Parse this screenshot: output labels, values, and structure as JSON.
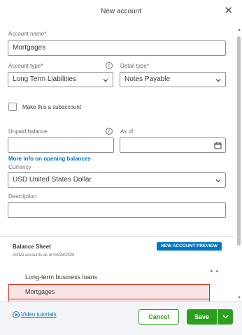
{
  "dialog": {
    "title": "New account",
    "close_icon": "close-icon"
  },
  "account_name": {
    "label": "Account name*",
    "value": "Mortgages"
  },
  "account_type": {
    "label": "Account type*",
    "value": "Long Term Liabilities",
    "info_icon": "info-icon"
  },
  "detail_type": {
    "label": "Detail type*",
    "value": "Notes Payable"
  },
  "subaccount": {
    "label": "Make this a subaccount",
    "checked": false
  },
  "unpaid_balance": {
    "label": "Unpaid balance",
    "value": "",
    "info_icon": "info-icon"
  },
  "as_of": {
    "label": "As of",
    "value": "",
    "icon": "calendar-icon"
  },
  "opening_balances_link": "More info on opening balances",
  "currency": {
    "label": "Currency",
    "value": "USD United States Dollar"
  },
  "description": {
    "label": "Description",
    "value": ""
  },
  "balance_sheet": {
    "title": "Balance Sheet",
    "subtitle": "Active accounts as of 04/28/2025",
    "badge": "NEW ACCOUNT PREVIEW",
    "items": [
      {
        "label": "Long-term business loans",
        "selected": false
      },
      {
        "label": "Mortgages",
        "selected": true
      }
    ]
  },
  "footer": {
    "video_tutorials": "Video tutorials",
    "cancel": "Cancel",
    "save": "Save"
  },
  "colors": {
    "primary_green": "#2ca01c",
    "link_blue": "#0077c5",
    "badge_blue": "#0077c5",
    "highlight_red": "#d52b1e"
  }
}
